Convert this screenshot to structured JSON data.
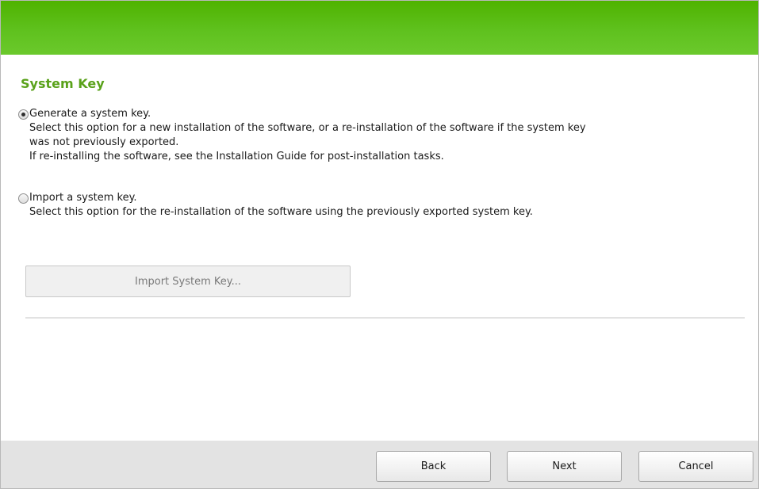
{
  "section_title": "System Key",
  "options": [
    {
      "label": "Generate a system key.",
      "selected": true,
      "description_lines": [
        "Select this option for a new installation of the software, or a re-installation of the software if the system key",
        "was not previously exported.",
        "If re-installing the software, see the Installation Guide for post-installation tasks."
      ]
    },
    {
      "label": "Import a system key.",
      "selected": false,
      "description_lines": [
        "Select this option for the re-installation of the software using the previously exported system key."
      ]
    }
  ],
  "import_button": {
    "label": "Import System Key...",
    "enabled": false
  },
  "footer": {
    "back_label": "Back",
    "next_label": "Next",
    "cancel_label": "Cancel"
  },
  "colors": {
    "banner_green": "#5fc11e",
    "title_green": "#5aa21b",
    "footer_gray": "#e3e3e3"
  }
}
